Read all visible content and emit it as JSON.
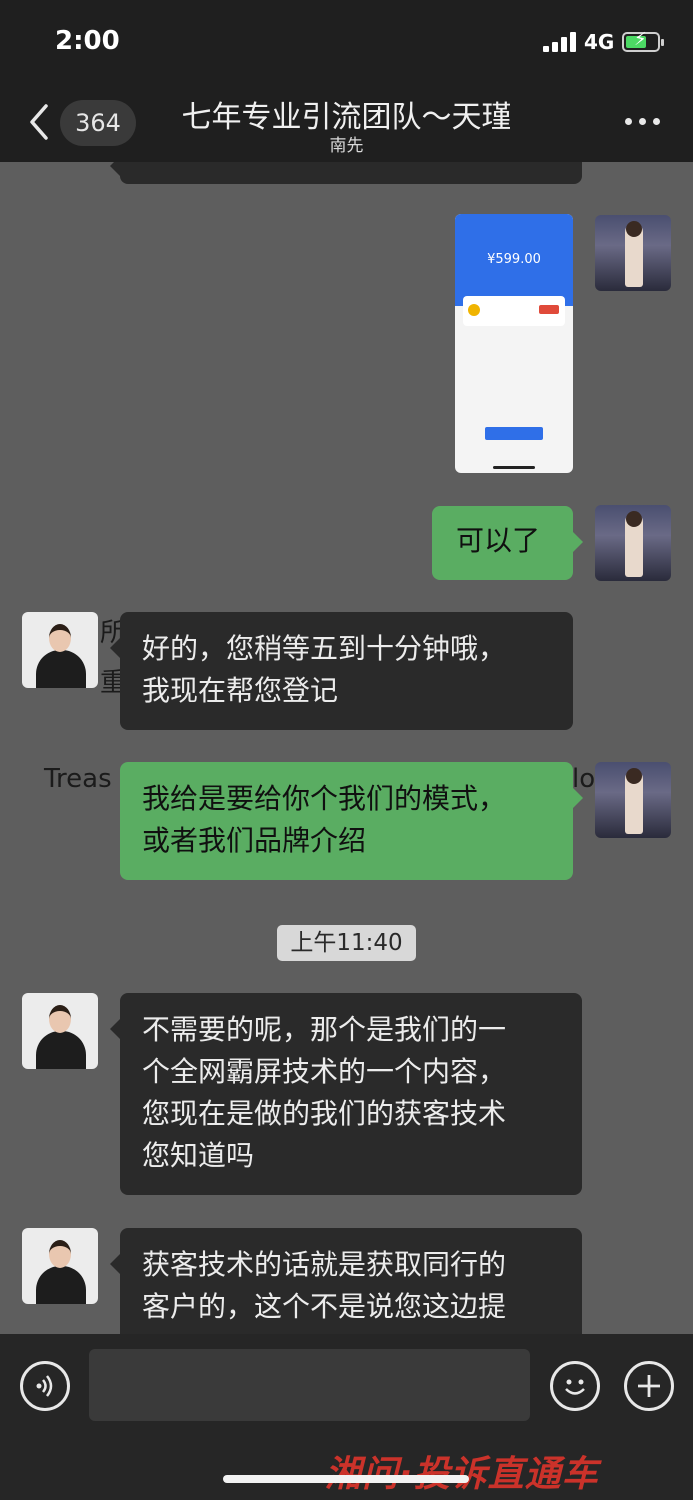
{
  "status": {
    "time": "2:00",
    "network": "4G"
  },
  "header": {
    "unread_count": "364",
    "title": "七年专业引流团队～天瑾",
    "subtitle": "南先"
  },
  "messages": {
    "payment_image": {
      "amount": "¥599.00"
    },
    "sent_1": "可以了",
    "received_1": {
      "line1": "好的，您稍等五到十分钟哦，",
      "line2": "我现在帮您登记"
    },
    "sent_2": {
      "line1": "我给是要给你个我们的模式，",
      "line2": "或者我们品牌介绍"
    },
    "timestamp": "上午11:40",
    "received_2": {
      "line1": "不需要的呢，那个是我们的一",
      "line2": "个全网霸屏技术的一个内容，",
      "line3": "您现在是做的我们的获客技术",
      "line4": "您知道吗"
    },
    "received_3": {
      "line1": "获客技术的话就是获取同行的",
      "line2": "客户的，这个不是说您这边提"
    }
  },
  "background_text": {
    "t1": "所",
    "t2": "重",
    "t3": "Treas",
    "t4": "lo"
  },
  "watermark": "湘问·投诉直通车",
  "colors": {
    "sent_bubble": "#5aad62",
    "received_bubble": "#2a2a2a",
    "accent_blue": "#2f6fe8"
  },
  "icons": [
    "back-icon",
    "more-icon",
    "voice-icon",
    "emoji-icon",
    "plus-icon"
  ]
}
